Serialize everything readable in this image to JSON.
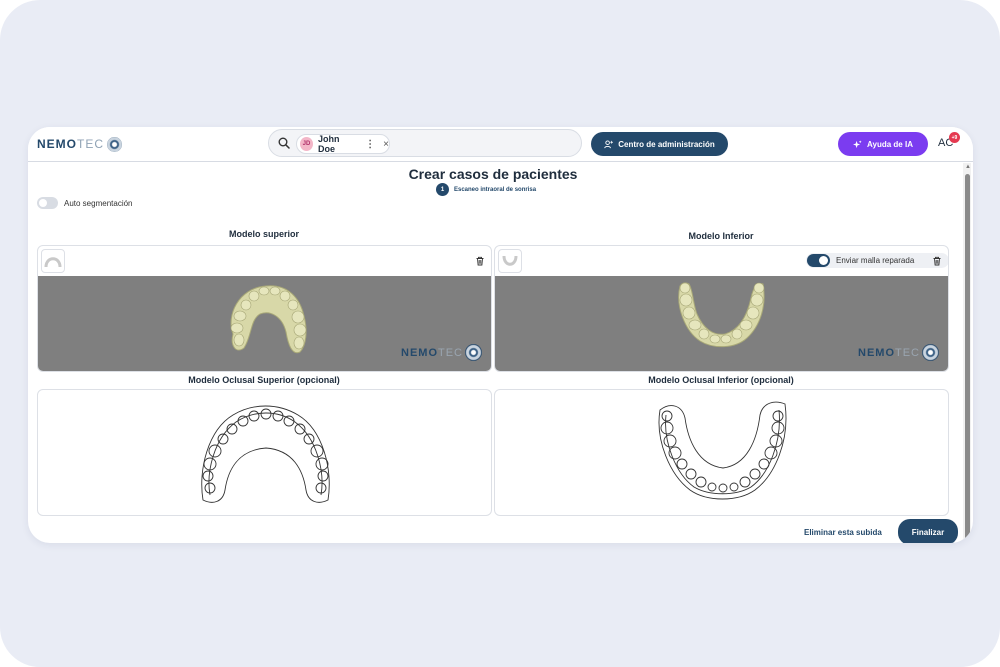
{
  "header": {
    "logo_main": "NEMO",
    "logo_sub": "TEC",
    "patient_initials": "JD",
    "patient_name": "John Doe",
    "chip_menu": "⋮",
    "chip_close": "×",
    "admin_label": "Centro de administración",
    "ai_label": "Ayuda de IA",
    "user_initials": "AC",
    "notification_count": "+9"
  },
  "page": {
    "title": "Crear casos de pacientes",
    "step_number": "1",
    "step_label": "Escaneo intraoral de sonrisa",
    "auto_segmentation_label": "Auto segmentación"
  },
  "upper_model": {
    "title": "Modelo superior",
    "watermark_main": "NEMO",
    "watermark_sub": "TEC"
  },
  "lower_model": {
    "title": "Modelo Inferior",
    "repair_label": "Enviar malla reparada",
    "repair_enabled": true,
    "watermark_main": "NEMO",
    "watermark_sub": "TEC"
  },
  "occlusal": {
    "upper_title": "Modelo Oclusal Superior (opcional)",
    "lower_title": "Modelo Oclusal Inferior (opcional)"
  },
  "footer": {
    "delete_label": "Eliminar esta subida",
    "finish_label": "Finalizar"
  },
  "colors": {
    "primary": "#24496b",
    "ai_purple": "#7b3cf0",
    "badge_red": "#e53950",
    "viewer_gray": "#7f7f7f",
    "model_color": "#d8d8a8"
  },
  "icons": {
    "search": "search-icon",
    "admin": "user-gear-icon",
    "ai": "sparkle-icon",
    "trash": "trash-icon",
    "upper_arch": "upper-arch-icon",
    "lower_arch": "lower-arch-icon"
  }
}
